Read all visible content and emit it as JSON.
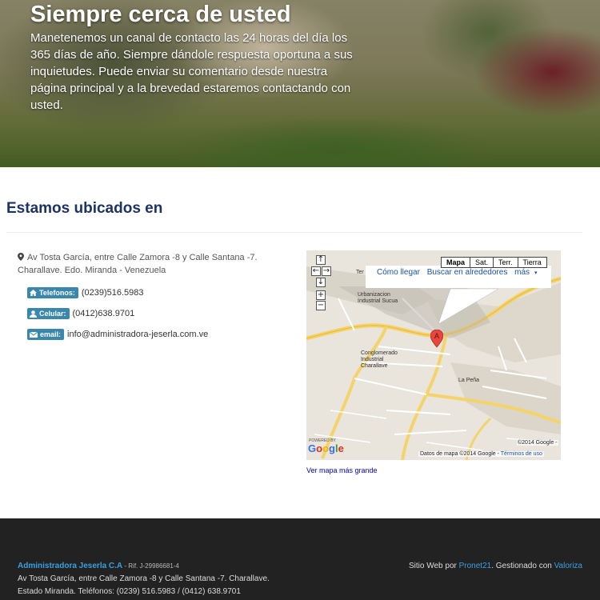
{
  "hero": {
    "title": "Siempre cerca de usted",
    "text": "Manetenemos un canal de contacto las 24 horas del día los 365 días de año. Siempre dándole respuesta oportuna a sus inquietudes. Puede enviar su comentario desde nuestra página principal y a la brevedad estaremos contactando con usted."
  },
  "location": {
    "heading": "Estamos ubicados en",
    "address": "Av Tosta García, entre Calle Zamora -8 y Calle Santana -7. Charallave. Edo. Miranda - Venezuela",
    "contacts": [
      {
        "label": "Telefonos:",
        "value": "(0239)516.5983",
        "icon": "home-icon"
      },
      {
        "label": "Celular:",
        "value": "(0412)638.9701",
        "icon": "user-icon"
      },
      {
        "label": "email:",
        "value": "info@administradora-jeserla.com.ve",
        "icon": "envelope-icon"
      }
    ]
  },
  "map": {
    "types": [
      "Mapa",
      "Sat.",
      "Terr.",
      "Tierra"
    ],
    "active_type": "Mapa",
    "links": [
      "Cómo llegar",
      "Buscar en alrededores",
      "más"
    ],
    "labels": {
      "urbanizacion": "Urbanizacion Industrial Sucua",
      "conglomerado": "Conglomerado Industrial Charallave",
      "la_pena": "La Peña",
      "ter": "Ter"
    },
    "marker": "A",
    "powered_by": "POWERED BY",
    "logo": "Google",
    "copyright": "©2014 Google -",
    "attribution": "Datos de mapa ©2014 Google -",
    "terms": "Términos de uso",
    "bigger_link": "Ver mapa más grande"
  },
  "footer": {
    "company": "Administradora Jeserla C.A",
    "rif": " - Rif. J-29986681-4",
    "line1": "Av Tosta García, entre Calle Zamora -8 y Calle Santana -7. Charallave.",
    "line2": "Estado Miranda. Teléfonos: (0239) 516.5983 / (0412) 638.9701",
    "credit_prefix": "Sitio Web por ",
    "credit_link1": "Pronet21",
    "credit_mid": ". Gestionado con ",
    "credit_link2": "Valoriza"
  },
  "colors": {
    "heading": "#1d3366",
    "badge": "#3a87ad",
    "footer_bg": "#222222",
    "link": "#39a0e0"
  }
}
